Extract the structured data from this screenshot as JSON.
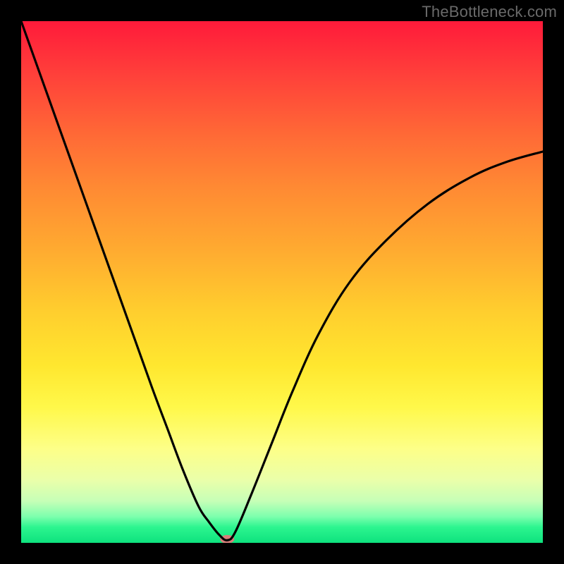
{
  "watermark": "TheBottleneck.com",
  "chart_data": {
    "type": "line",
    "title": "",
    "xlabel": "",
    "ylabel": "",
    "xlim": [
      0,
      100
    ],
    "ylim": [
      0,
      100
    ],
    "series": [
      {
        "name": "bottleneck-curve",
        "x": [
          0,
          5,
          10,
          15,
          20,
          25,
          28,
          31,
          34,
          36,
          38,
          39.5,
          41,
          44,
          48,
          52,
          57,
          63,
          70,
          78,
          86,
          93,
          100
        ],
        "values": [
          100,
          86,
          72,
          58,
          44,
          30,
          22,
          14,
          7,
          4,
          1.5,
          0.5,
          2,
          9,
          19,
          29,
          40,
          50,
          58,
          65,
          70,
          73,
          75
        ]
      }
    ],
    "markers": [
      {
        "name": "minimum-marker",
        "x": 39.5,
        "y": 0.7,
        "color": "#d77e7a",
        "rx": 10,
        "ry": 6
      }
    ],
    "background_gradient": {
      "top": "#ff1a3a",
      "middle": "#ffe72f",
      "bottom": "#0ee27e"
    }
  }
}
